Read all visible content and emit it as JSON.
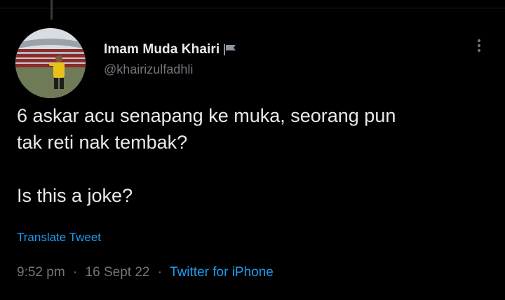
{
  "author": {
    "name": "Imam Muda Khairi",
    "handle": "@khairizulfadhli",
    "badge_icon": "flag-icon",
    "avatar_icon": "profile-photo"
  },
  "menu": {
    "icon": "more-options-icon"
  },
  "tweet": {
    "lines": [
      "6 askar acu senapang ke muka, seorang pun",
      "tak reti nak tembak?",
      "Is this a joke?"
    ],
    "translate_label": "Translate Tweet"
  },
  "meta": {
    "time": "9:52 pm",
    "separator": "·",
    "date": "16 Sept 22",
    "source": "Twitter for iPhone"
  },
  "colors": {
    "background": "#000000",
    "text": "#e7e9ea",
    "secondary": "#71767b",
    "link": "#1d9bf0"
  }
}
